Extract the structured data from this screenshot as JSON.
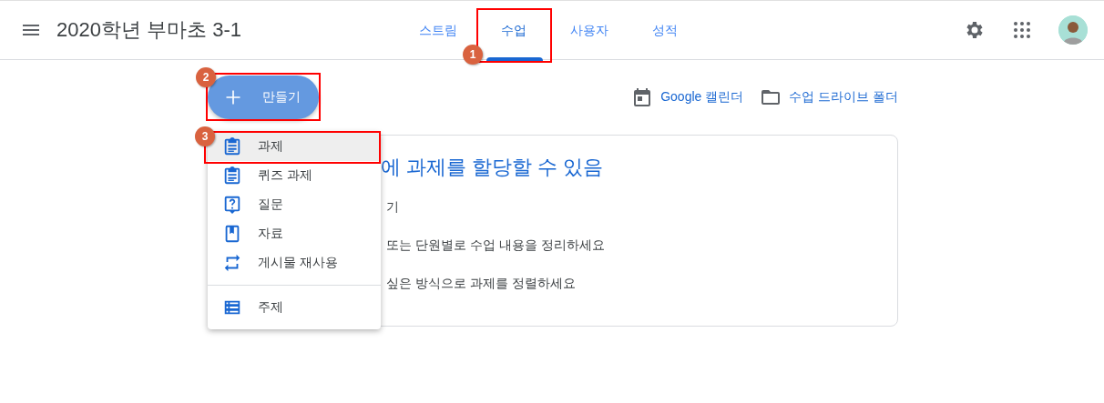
{
  "header": {
    "title": "2020학년 부마초 3-1"
  },
  "tabs": [
    {
      "label": "스트림",
      "selected": false
    },
    {
      "label": "수업",
      "selected": true,
      "callout": "1"
    },
    {
      "label": "사용자",
      "selected": false
    },
    {
      "label": "성적",
      "selected": false
    }
  ],
  "create_button": {
    "label": "만들기",
    "callout": "2"
  },
  "links": [
    {
      "kind": "calendar",
      "label": "Google 캘린더"
    },
    {
      "kind": "folder",
      "label": "수업 드라이브 폴더"
    }
  ],
  "card": {
    "title": "에 과제를 할당할 수 있음",
    "lines": [
      "기",
      "또는 단원별로 수업 내용을 정리하세요",
      "싶은 방식으로 과제를 정렬하세요"
    ]
  },
  "create_menu": {
    "groups": [
      [
        {
          "kind": "assignment",
          "label": "과제",
          "selected": true,
          "callout": "3"
        },
        {
          "kind": "quiz",
          "label": "퀴즈 과제",
          "selected": false
        },
        {
          "kind": "question",
          "label": "질문",
          "selected": false
        },
        {
          "kind": "material",
          "label": "자료",
          "selected": false
        },
        {
          "kind": "reuse",
          "label": "게시물 재사용",
          "selected": false
        }
      ],
      [
        {
          "kind": "topic",
          "label": "주제",
          "selected": false
        }
      ]
    ]
  }
}
